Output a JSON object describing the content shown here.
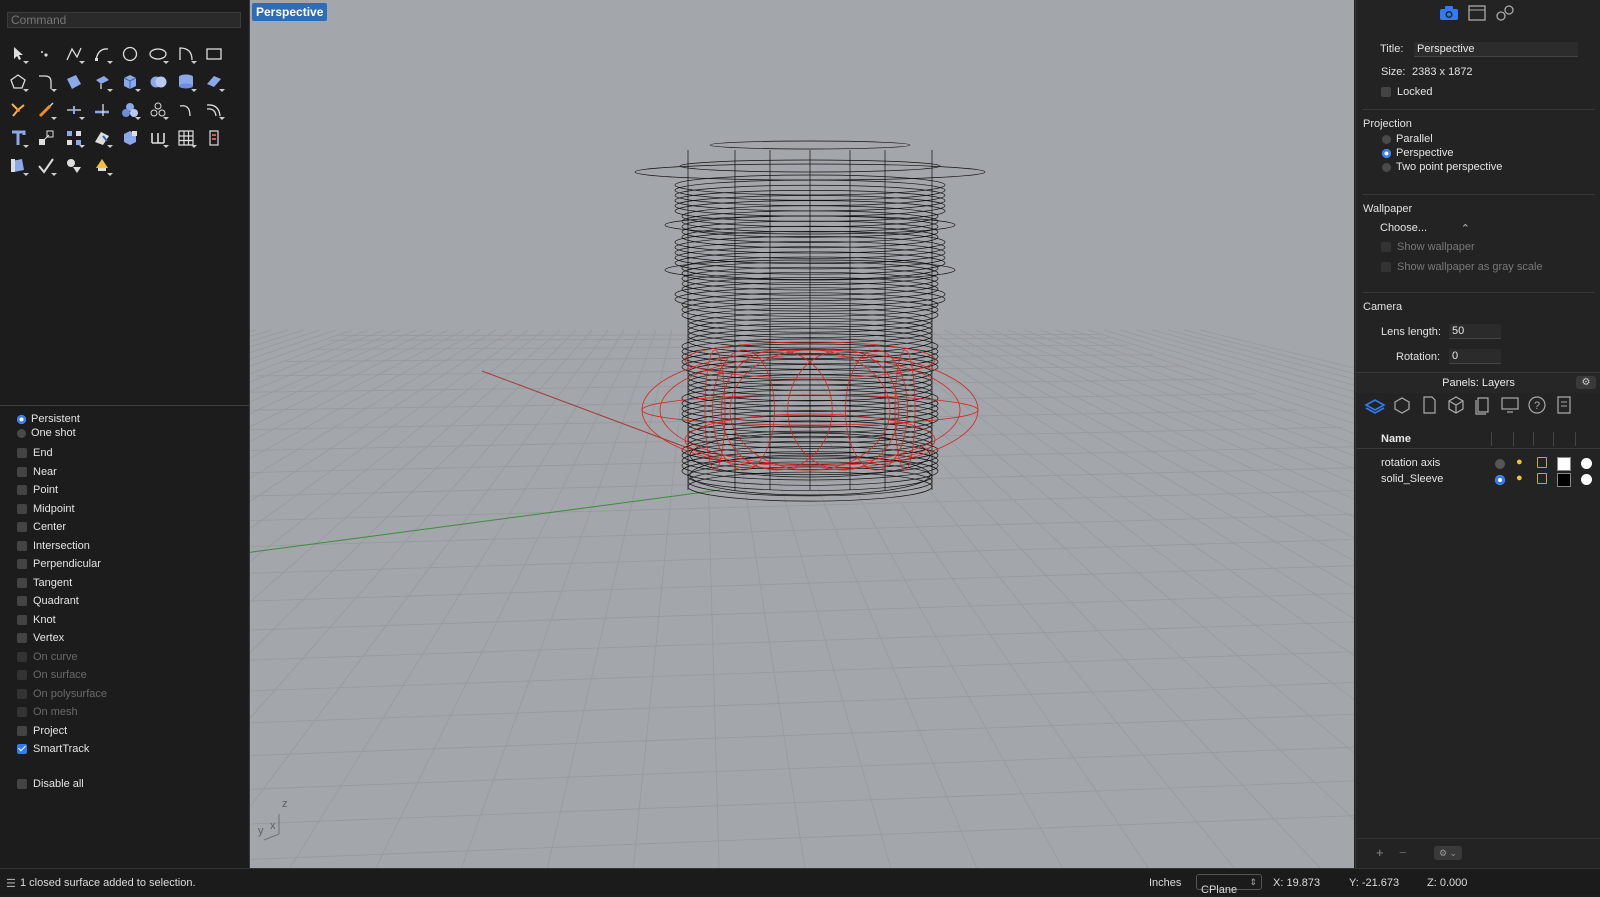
{
  "command": {
    "placeholder": "Command"
  },
  "viewport": {
    "tab_label": "Perspective",
    "axes": {
      "z": "z",
      "y": "y",
      "x": "x"
    }
  },
  "osnap": {
    "modes": [
      {
        "label": "Persistent",
        "selected": true
      },
      {
        "label": "One shot",
        "selected": false
      }
    ],
    "items": [
      {
        "label": "End",
        "checked": false,
        "enabled": true
      },
      {
        "label": "Near",
        "checked": false,
        "enabled": true
      },
      {
        "label": "Point",
        "checked": false,
        "enabled": true
      },
      {
        "label": "Midpoint",
        "checked": false,
        "enabled": true
      },
      {
        "label": "Center",
        "checked": false,
        "enabled": true
      },
      {
        "label": "Intersection",
        "checked": false,
        "enabled": true
      },
      {
        "label": "Perpendicular",
        "checked": false,
        "enabled": true
      },
      {
        "label": "Tangent",
        "checked": false,
        "enabled": true
      },
      {
        "label": "Quadrant",
        "checked": false,
        "enabled": true
      },
      {
        "label": "Knot",
        "checked": false,
        "enabled": true
      },
      {
        "label": "Vertex",
        "checked": false,
        "enabled": true
      },
      {
        "label": "On curve",
        "checked": false,
        "enabled": false
      },
      {
        "label": "On surface",
        "checked": false,
        "enabled": false
      },
      {
        "label": "On polysurface",
        "checked": false,
        "enabled": false
      },
      {
        "label": "On mesh",
        "checked": false,
        "enabled": false
      },
      {
        "label": "Project",
        "checked": false,
        "enabled": true
      },
      {
        "label": "SmartTrack",
        "checked": true,
        "enabled": true
      }
    ],
    "disable_all": "Disable all"
  },
  "props": {
    "title_label": "Title:",
    "title_value": "Perspective",
    "size_label": "Size:",
    "size_value": "2383 x 1872",
    "locked_label": "Locked",
    "projection_header": "Projection",
    "projection_options": [
      {
        "label": "Parallel",
        "selected": false
      },
      {
        "label": "Perspective",
        "selected": true
      },
      {
        "label": "Two point perspective",
        "selected": false
      }
    ],
    "wallpaper_header": "Wallpaper",
    "wallpaper_choose": "Choose...",
    "show_wallpaper": "Show wallpaper",
    "show_wallpaper_gray": "Show wallpaper as gray scale",
    "camera_header": "Camera",
    "lens_label": "Lens length:",
    "lens_value": "50",
    "rotation_label": "Rotation:",
    "rotation_value": "0"
  },
  "layers": {
    "panel_title": "Panels: Layers",
    "name_col": "Name",
    "rows": [
      {
        "name": "rotation axis",
        "current": false,
        "color": "#ffffff"
      },
      {
        "name": "solid_Sleeve",
        "current": true,
        "color": "#000000"
      }
    ],
    "add": "+",
    "remove": "−"
  },
  "status": {
    "message": "1 closed surface added to selection.",
    "units": "Inches",
    "cplane": "CPlane",
    "x": "X: 19.873",
    "y": "Y: -21.673",
    "z": "Z: 0.000"
  },
  "colors": {
    "accent": "#2f7cf6",
    "tab": "#2d6db8",
    "viewport_bg": "#a3a6aa",
    "selection": "#d8231f"
  }
}
